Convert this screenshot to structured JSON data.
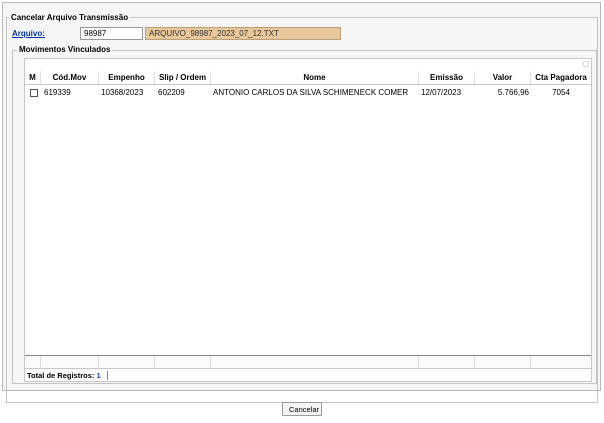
{
  "form": {
    "title": "Cancelar Arquivo Transmissão",
    "arquivo_label": "Arquivo:",
    "arquivo_code": "98987",
    "arquivo_name": "ARQUIVO_98987_2023_07_12.TXT"
  },
  "movimentos": {
    "title": "Movimentos Vinculados",
    "columns": [
      "M",
      "Cód.Mov",
      "Empenho",
      "Slip / Ordem",
      "Nome",
      "Emissão",
      "Valor",
      "Cta Pagadora"
    ],
    "rows": [
      {
        "checked": false,
        "cod_mov": "619339",
        "empenho": "10368/2023",
        "slip": "602209",
        "nome": "ANTONIO CARLOS DA SILVA SCHIMENECK COMER",
        "emissao": "12/07/2023",
        "valor": "5.766,96",
        "cta": "7054"
      }
    ],
    "total_label": "Total de Registros:",
    "total_value": "1"
  },
  "actions": {
    "cancel_label": "Cancelar"
  }
}
